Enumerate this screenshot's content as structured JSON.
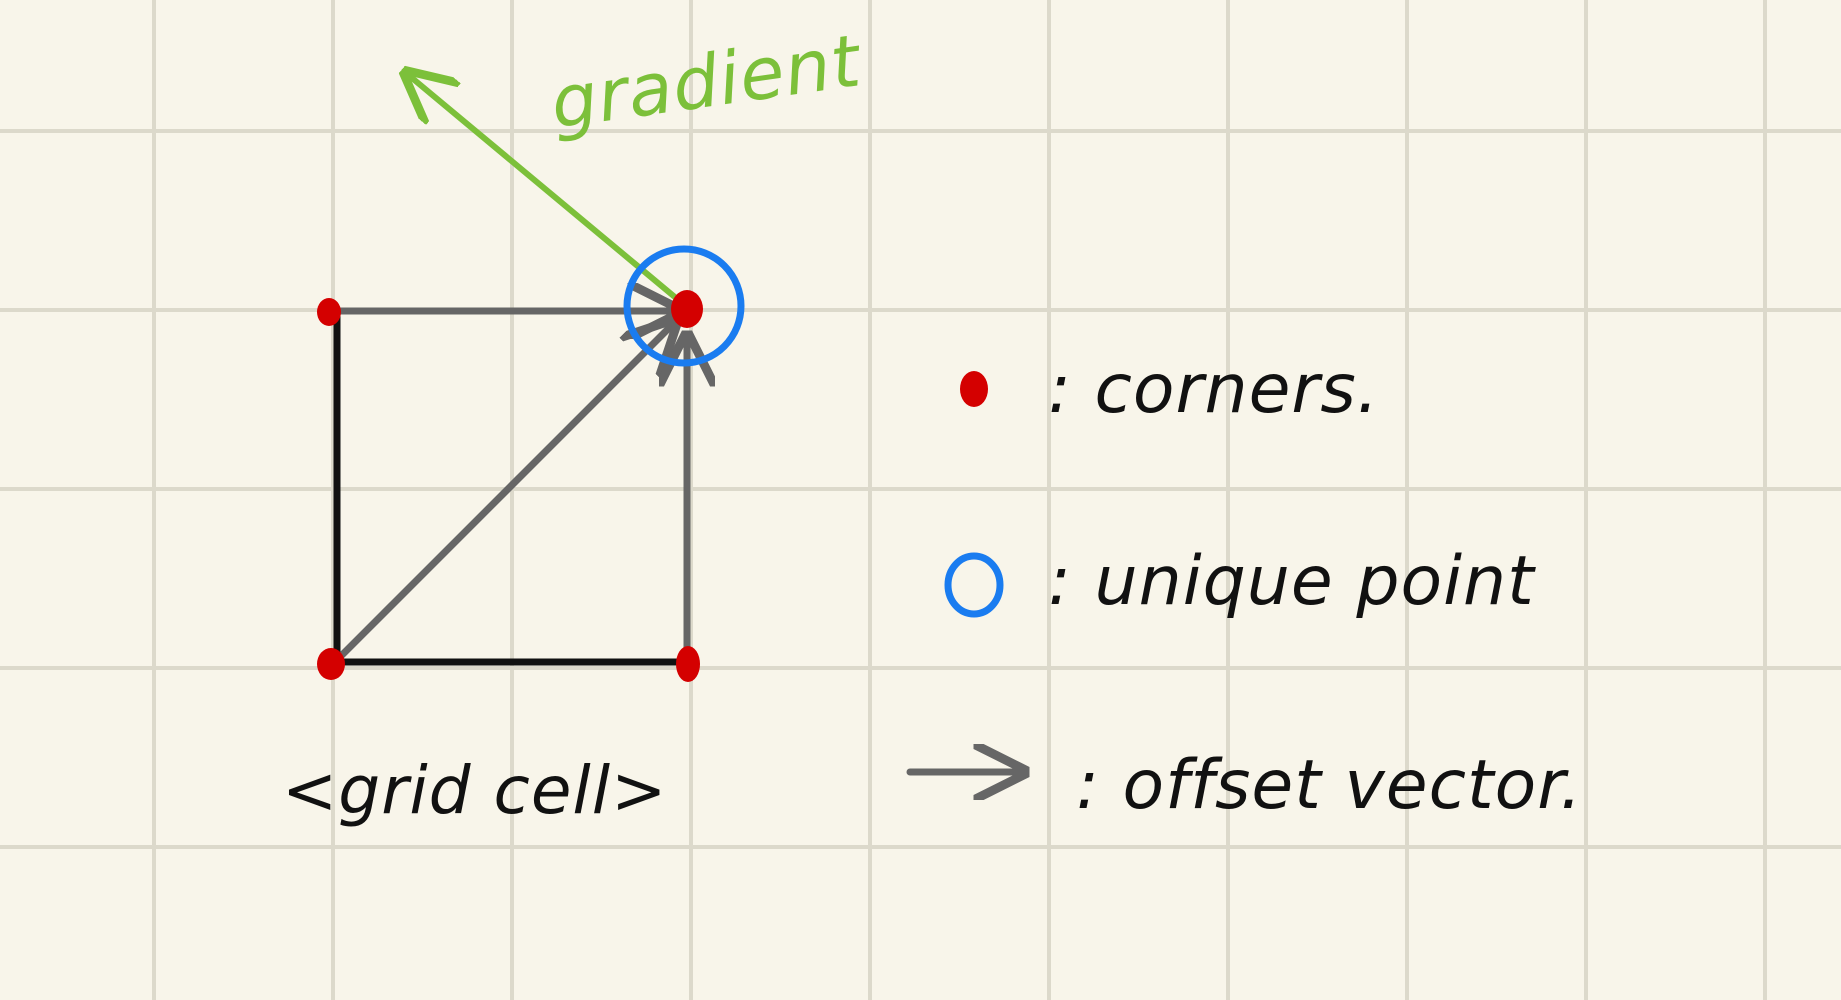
{
  "diagram": {
    "cell_label": "<grid cell>",
    "gradient_label": "gradient",
    "legend": [
      {
        "symbol": "red-dot",
        "text": ": corners."
      },
      {
        "symbol": "blue-circle",
        "text": ": unique point"
      },
      {
        "symbol": "gray-arrow",
        "text": ": offset vector."
      }
    ]
  },
  "colors": {
    "background": "#f8f5ea",
    "grid": "#dcd9cb",
    "corner": "#d40000",
    "unique_point": "#1a7cf0",
    "offset_vector": "#666666",
    "gradient": "#7cc03a",
    "ink": "#111111"
  }
}
